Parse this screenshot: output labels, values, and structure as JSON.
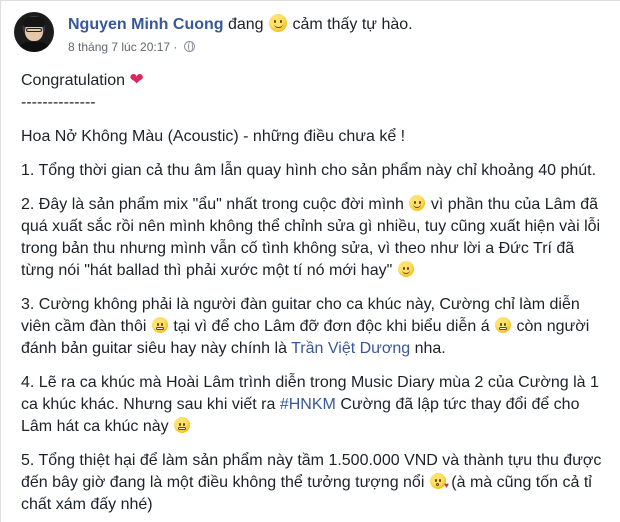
{
  "post": {
    "author": "Nguyen Minh Cuong",
    "feeling_prefix": "đang",
    "feeling_text": "cảm thấy tự hào.",
    "timestamp": "8 tháng 7 lúc 20:17 ·",
    "icons": {
      "feeling": "smiling-face-icon",
      "privacy": "globe-icon"
    },
    "lines": {
      "congrats": "Congratulation",
      "divider": "--------------",
      "title": "Hoa Nở Không Màu (Acoustic) - những điều chưa kể !",
      "p1": "1. Tổng thời gian cả thu âm lẫn quay hình cho sản phẩm này chỉ khoảng 40 phút.",
      "p2a": "2. Đây là sản phẩm mix \"ẩu\" nhất trong cuộc đời mình",
      "p2b": "vì phần thu của Lâm đã quá xuất sắc rồi nên mình không thể chỉnh sửa gì nhiều, tuy cũng xuất hiện vài lỗi trong bản thu nhưng mình vẫn cố tình không sửa, vì theo như lời a Đức Trí đã từng nói \"hát ballad thì phải xước một tí nó mới hay\"",
      "p3a": "3. Cường không phải là người đàn guitar cho ca khúc này, Cường chỉ làm diễn viên cầm đàn thôi",
      "p3b": "tại vì để cho Lâm đỡ đơn độc khi biểu diễn á",
      "p3c": "còn người đánh bản guitar siêu hay này chính là",
      "p3_link": "Trần Việt Dương",
      "p3d": "nha.",
      "p4a": "4. Lẽ ra ca khúc mà Hoài Lâm trình diễn trong Music Diary mùa 2 của Cường là 1 ca khúc khác. Nhưng sau khi viết ra",
      "p4_link": "#HNKM",
      "p4b": "Cường đã lập tức thay đổi để cho Lâm hát ca khúc này",
      "p5a": "5. Tổng thiệt hại để làm sản phẩm này tầm 1.500.000 VND và thành tựu thu được đến bây giờ đang là một điều không thể tưởng tượng nổi",
      "p5b": "(à mà cũng tốn cả tỉ chất xám đấy nhé)"
    }
  }
}
